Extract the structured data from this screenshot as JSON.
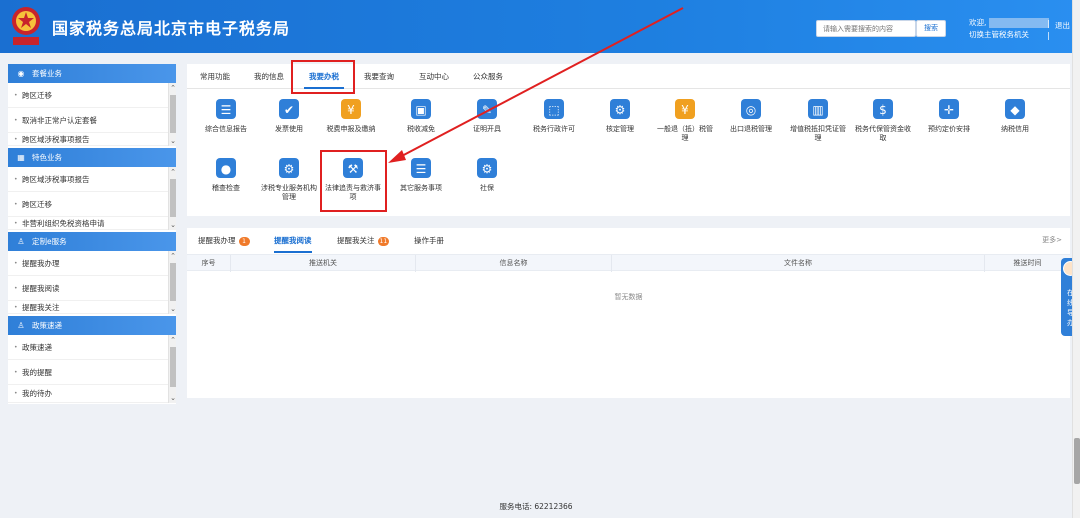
{
  "header": {
    "title": "国家税务总局北京市电子税务局",
    "search_placeholder": "请输入需要搜索的内容",
    "search_button": "搜索",
    "welcome": "欢迎,",
    "switch_authority": "切换主管税务机关",
    "separator": "|",
    "logout": "退出",
    "logo_text": "税务局"
  },
  "sidebar": {
    "sections": [
      {
        "title": "套餐业务",
        "icon": "package-icon",
        "items": [
          "跨区迁移",
          "取消非正常户认定套餐",
          "跨区域涉税事项报告"
        ]
      },
      {
        "title": "特色业务",
        "icon": "grid-icon",
        "items": [
          "跨区域涉税事项报告",
          "跨区迁移",
          "非营利组织免税资格申请"
        ]
      },
      {
        "title": "定制e服务",
        "icon": "user-icon",
        "items": [
          "提醒我办理",
          "提醒我阅读",
          "提醒我关注"
        ]
      },
      {
        "title": "政策速递",
        "icon": "user-icon",
        "items": [
          "政策速递",
          "我的提醒",
          "我的待办"
        ]
      }
    ]
  },
  "top_tabs": [
    "常用功能",
    "我的信息",
    "我要办税",
    "我要查询",
    "互动中心",
    "公众服务"
  ],
  "active_top_tab": "我要办税",
  "functions": [
    {
      "label": "综合信息报告",
      "icon": "report-icon",
      "color": "#2f7fd8"
    },
    {
      "label": "发票使用",
      "icon": "invoice-icon",
      "color": "#2f7fd8"
    },
    {
      "label": "税费申报及缴纳",
      "icon": "tax-payment-icon",
      "color": "#f0a020"
    },
    {
      "label": "税收减免",
      "icon": "tax-relief-icon",
      "color": "#2f7fd8"
    },
    {
      "label": "证明开具",
      "icon": "certificate-icon",
      "color": "#2f7fd8"
    },
    {
      "label": "税务行政许可",
      "icon": "permit-icon",
      "color": "#2f7fd8"
    },
    {
      "label": "核定管理",
      "icon": "user-gear-icon",
      "color": "#2f7fd8"
    },
    {
      "label": "一般退（抵）税管理",
      "icon": "refund-icon",
      "color": "#f0a020"
    },
    {
      "label": "出口退税管理",
      "icon": "globe-icon",
      "color": "#2f7fd8"
    },
    {
      "label": "增值税抵扣凭证管理",
      "icon": "voucher-icon",
      "color": "#2f7fd8"
    },
    {
      "label": "税务代保管资金收取",
      "icon": "money-bag-icon",
      "color": "#2f7fd8"
    },
    {
      "label": "预约定价安排",
      "icon": "target-icon",
      "color": "#2f7fd8"
    },
    {
      "label": "纳税信用",
      "icon": "credit-diamond-icon",
      "color": "#2f7fd8"
    },
    {
      "label": "稽查检查",
      "icon": "inspector-icon",
      "color": "#2f7fd8"
    },
    {
      "label": "涉税专业服务机构管理",
      "icon": "user-gear-icon",
      "color": "#2f7fd8"
    },
    {
      "label": "法律追责与救济事项",
      "icon": "gavel-icon",
      "color": "#2f7fd8"
    },
    {
      "label": "其它服务事项",
      "icon": "clipboard-icon",
      "color": "#2f7fd8"
    },
    {
      "label": "社保",
      "icon": "user-gear-icon",
      "color": "#2f7fd8"
    }
  ],
  "remind": {
    "tabs": [
      {
        "label": "提醒我办理",
        "badge": "1"
      },
      {
        "label": "提醒我阅读",
        "badge": ""
      },
      {
        "label": "提醒我关注",
        "badge": "11"
      },
      {
        "label": "操作手册",
        "badge": ""
      }
    ],
    "active_tab": "提醒我阅读",
    "more": "更多>",
    "columns": [
      "序号",
      "推送机关",
      "信息名称",
      "文件名称",
      "推送时间"
    ],
    "empty_text": "暂无数据"
  },
  "help_float": "在线导办",
  "footer": "服务电话: 62212366",
  "colors": {
    "primary": "#1a6fd1",
    "highlight": "#e02020",
    "badge": "#f07a2b"
  }
}
